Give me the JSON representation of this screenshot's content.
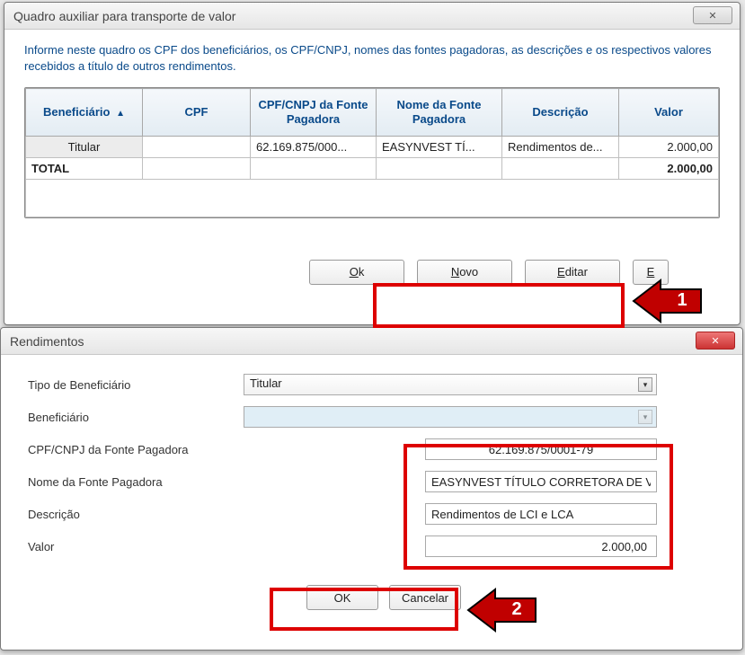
{
  "window1": {
    "title": "Quadro auxiliar para transporte de valor",
    "close": "✕",
    "intro": "Informe neste quadro os CPF dos beneficiários, os CPF/CNPJ, nomes das fontes pagadoras, as descrições e os respectivos valores recebidos a título de outros rendimentos.",
    "headers": {
      "beneficiario": "Beneficiário",
      "cpf": "CPF",
      "cpfcnpj": "CPF/CNPJ da Fonte Pagadora",
      "nome": "Nome da Fonte Pagadora",
      "descricao": "Descrição",
      "valor": "Valor"
    },
    "row": {
      "beneficiario": "Titular",
      "cpf": "",
      "cpfcnpj": "62.169.875/000...",
      "nome": "EASYNVEST TÍ...",
      "descricao": "Rendimentos de...",
      "valor": "2.000,00"
    },
    "total_label": "TOTAL",
    "total_valor": "2.000,00",
    "buttons": {
      "ok_pre": "O",
      "ok_u": "k",
      "novo_u": "N",
      "novo_rest": "ovo",
      "editar_u": "E",
      "editar_rest": "ditar",
      "extra_u": "E"
    }
  },
  "window2": {
    "title": "Rendimentos",
    "close": "✕",
    "labels": {
      "tipo": "Tipo de Beneficiário",
      "beneficiario": "Beneficiário",
      "cpfcnpj": "CPF/CNPJ da Fonte Pagadora",
      "nome": "Nome da Fonte Pagadora",
      "descricao": "Descrição",
      "valor": "Valor"
    },
    "values": {
      "tipo": "Titular",
      "beneficiario": "",
      "cpfcnpj": "62.169.875/0001-79",
      "nome": "EASYNVEST TÍTULO CORRETORA DE V",
      "descricao": "Rendimentos de LCI e LCA",
      "valor": "2.000,00"
    },
    "buttons": {
      "ok": "OK",
      "cancelar": "Cancelar"
    }
  },
  "annotations": {
    "num1": "1",
    "num2": "2"
  }
}
